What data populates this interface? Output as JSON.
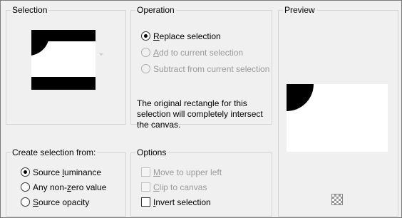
{
  "selection": {
    "title": "Selection"
  },
  "operation": {
    "title": "Operation",
    "options": [
      {
        "prefix": "",
        "mnemonic": "R",
        "suffix": "eplace selection",
        "checked": true,
        "enabled": true
      },
      {
        "prefix": "",
        "mnemonic": "A",
        "suffix": "dd to current selection",
        "checked": false,
        "enabled": false
      },
      {
        "prefix": "Subtract from current selection",
        "mnemonic": "",
        "suffix": "",
        "checked": false,
        "enabled": false
      }
    ],
    "info_lines": [
      "The original rectangle for this",
      "selection will completely intersect",
      "the canvas."
    ]
  },
  "preview": {
    "title": "Preview",
    "icon": "checkerboard-icon"
  },
  "create_from": {
    "title": "Create selection from:",
    "options": [
      {
        "prefix": "Source ",
        "mnemonic": "l",
        "suffix": "uminance",
        "checked": true
      },
      {
        "prefix": "Any non-",
        "mnemonic": "z",
        "suffix": "ero value",
        "checked": false
      },
      {
        "prefix": "",
        "mnemonic": "S",
        "suffix": "ource opacity",
        "checked": false
      }
    ]
  },
  "options": {
    "title": "Options",
    "items": [
      {
        "prefix": "",
        "mnemonic": "M",
        "suffix": "ove to upper left",
        "checked": false,
        "enabled": false
      },
      {
        "prefix": "",
        "mnemonic": "C",
        "suffix": "lip to canvas",
        "checked": false,
        "enabled": false
      },
      {
        "prefix": "",
        "mnemonic": "I",
        "suffix": "nvert selection",
        "checked": false,
        "enabled": true
      }
    ]
  },
  "colors": {
    "frame_border": "#7a7a7a",
    "group_border": "#d5d5d5",
    "background": "#f0f0f0",
    "disabled_text": "#9a9a9a"
  }
}
